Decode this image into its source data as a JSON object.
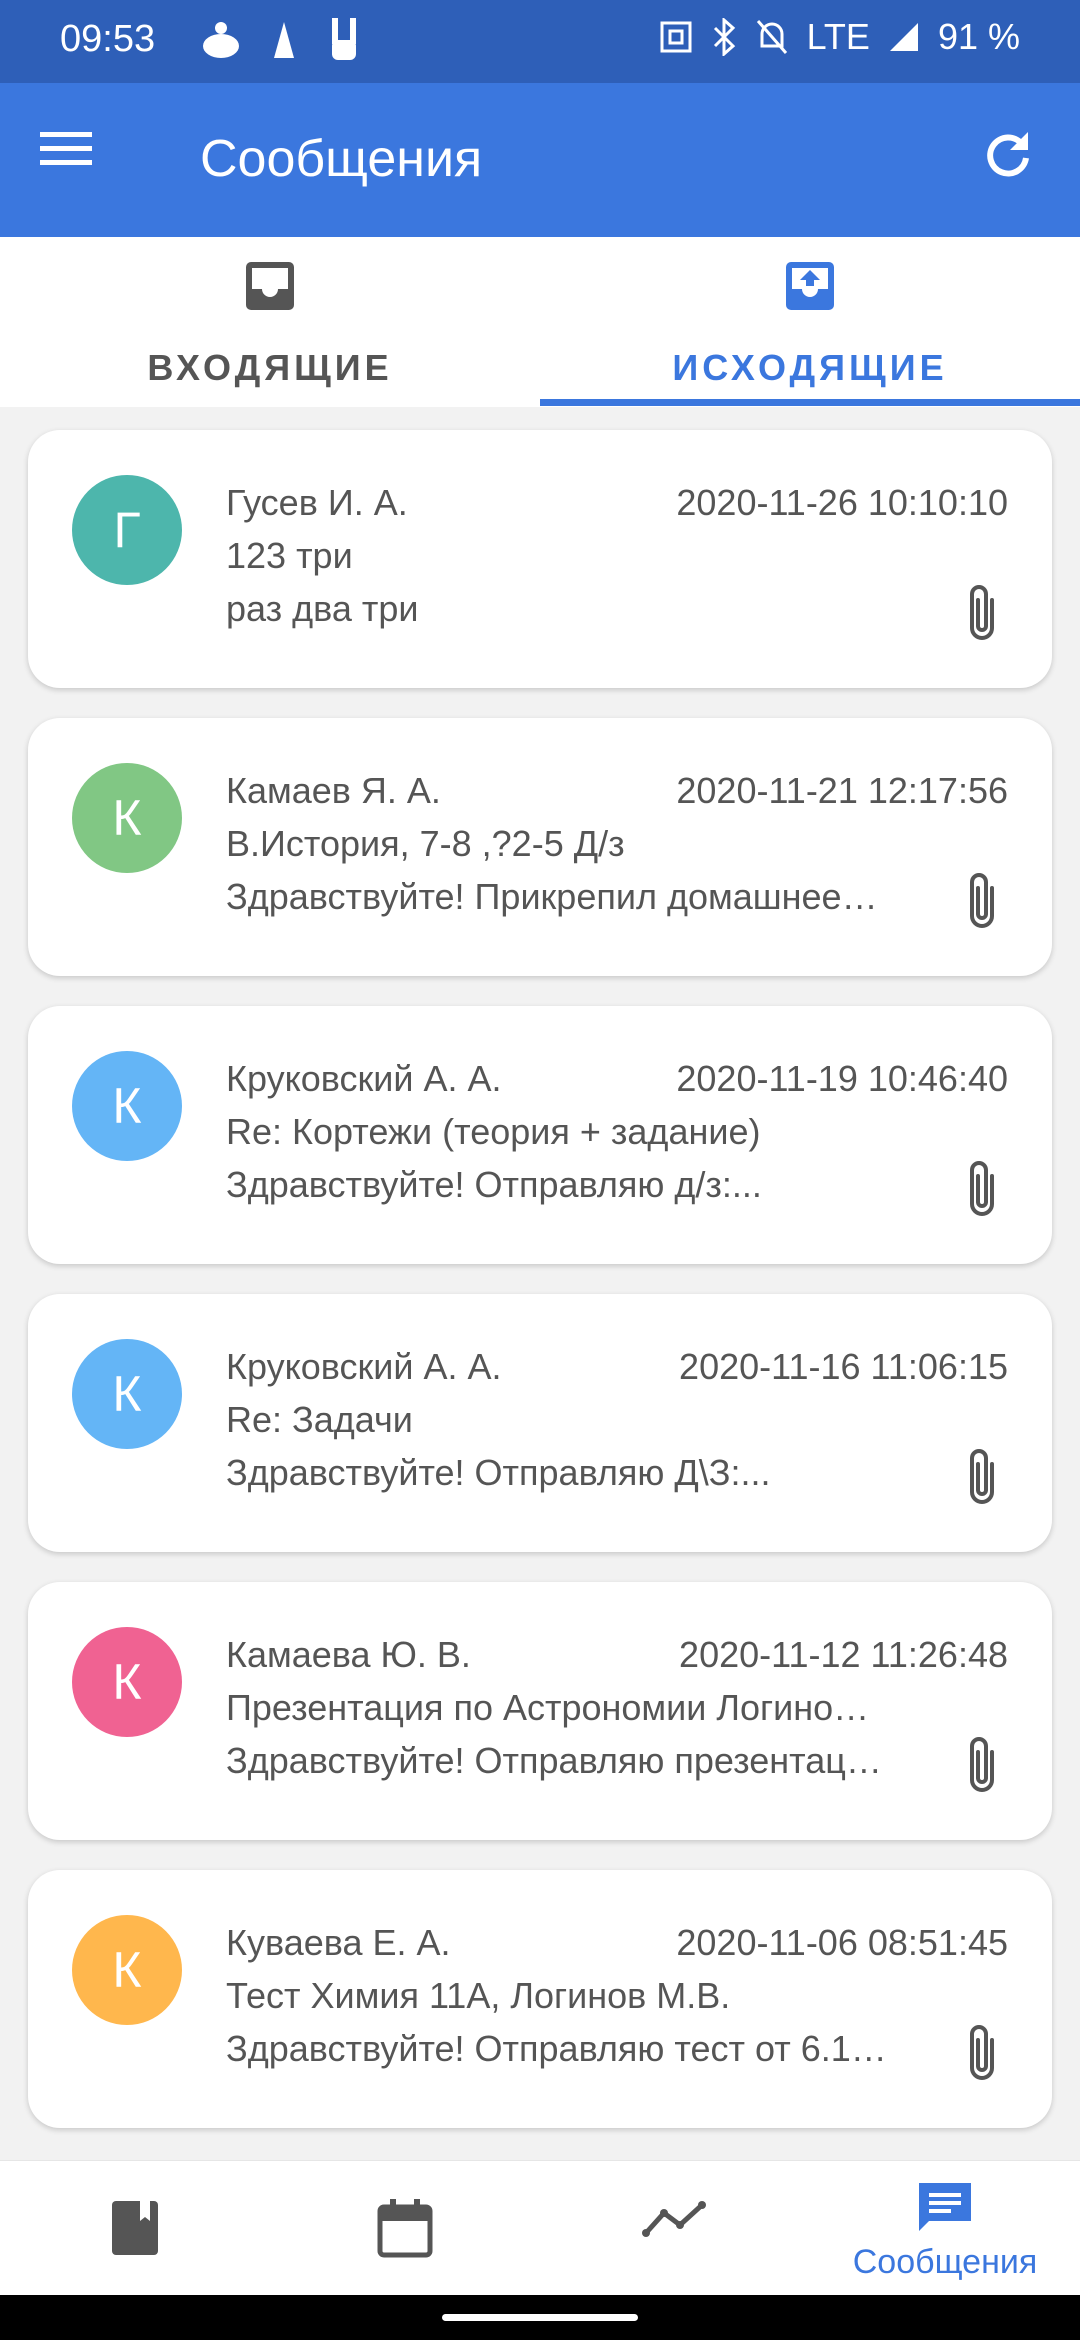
{
  "status_bar": {
    "time": "09:53",
    "network": "LTE",
    "battery": "91 %"
  },
  "app_bar": {
    "title": "Сообщения"
  },
  "tabs": [
    {
      "label": "ВХОДЯЩИЕ",
      "icon": "inbox-icon",
      "active": false
    },
    {
      "label": "ИСХОДЯЩИЕ",
      "icon": "outbox-icon",
      "active": true
    }
  ],
  "messages": [
    {
      "avatar_letter": "Г",
      "avatar_color": "#4db6ac",
      "sender": "Гусев И. А.",
      "date": "2020-11-26 10:10:10",
      "subject": "123 три",
      "preview": "раз два три",
      "has_attachment": true
    },
    {
      "avatar_letter": "К",
      "avatar_color": "#81c784",
      "sender": "Камаев Я. А.",
      "date": "2020-11-21 12:17:56",
      "subject": "В.История, 7-8 ,?2-5 Д/з",
      "preview": "Здравствуйте! Прикрепил домашнее…",
      "has_attachment": true
    },
    {
      "avatar_letter": "К",
      "avatar_color": "#64b5f6",
      "sender": "Круковский А. А.",
      "date": "2020-11-19 10:46:40",
      "subject": "Re: Кортежи (теория + задание)",
      "preview": "Здравствуйте! Отправляю д/з:...",
      "has_attachment": true
    },
    {
      "avatar_letter": "К",
      "avatar_color": "#64b5f6",
      "sender": "Круковский А. А.",
      "date": "2020-11-16 11:06:15",
      "subject": "Re: Задачи",
      "preview": "Здравствуйте! Отправляю Д\\З:...",
      "has_attachment": true
    },
    {
      "avatar_letter": "К",
      "avatar_color": "#f06292",
      "sender": "Камаева Ю. В.",
      "date": "2020-11-12 11:26:48",
      "subject": "Презентация по Астрономии Логино…",
      "preview": "Здравствуйте! Отправляю презентац…",
      "has_attachment": true
    },
    {
      "avatar_letter": "К",
      "avatar_color": "#ffb74d",
      "sender": "Куваева Е. А.",
      "date": "2020-11-06 08:51:45",
      "subject": "Тест Химия 11А, Логинов М.В.",
      "preview": "Здравствуйте! Отправляю тест от 6.1…",
      "has_attachment": true
    }
  ],
  "bottom_nav": [
    {
      "icon": "book-icon",
      "label": ""
    },
    {
      "icon": "calendar-icon",
      "label": ""
    },
    {
      "icon": "trend-icon",
      "label": ""
    },
    {
      "icon": "chat-icon",
      "label": "Сообщения",
      "active": true
    }
  ],
  "colors": {
    "primary": "#3b77de",
    "status_bar": "#2e5fb8",
    "text": "#555555"
  }
}
